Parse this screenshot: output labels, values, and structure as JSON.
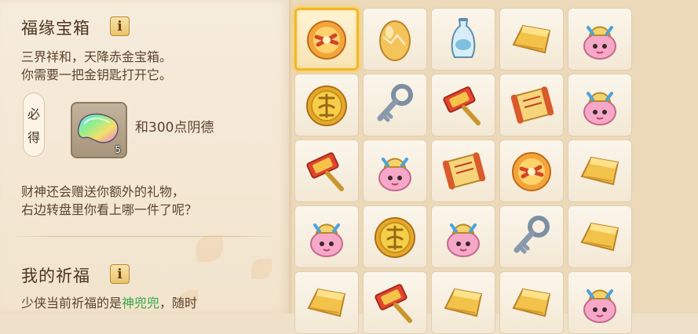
{
  "treasure": {
    "title": "福缘宝箱",
    "info_label": "i",
    "desc_line1": "三界祥和，天降赤金宝箱。",
    "desc_line2": "你需要一把金钥匙打开它。",
    "must_char1": "必",
    "must_char2": "得",
    "reward_qty": "5",
    "reward_text": "和300点阴德",
    "gift_line1": "财神还会赠送你额外的礼物，",
    "gift_line2": "右边转盘里你看上哪一件了呢？"
  },
  "blessing": {
    "title": "我的祈福",
    "info_label": "i",
    "line_prefix": "少侠当前祈福的是",
    "highlight": "神兜兜",
    "line_suffix": "，随时"
  },
  "colors": {
    "highlight": "#3aa84a",
    "selected_border": "#f0b72a",
    "title_text": "#4b3320"
  },
  "grid_items": [
    [
      "gold-medallion-icon",
      "golden-egg-icon",
      "porcelain-vase-icon",
      "gold-ingot-icon",
      "lucky-bag-doll-icon"
    ],
    [
      "dream-coin-icon",
      "silver-key-icon",
      "red-hammer-icon",
      "scroll-icon",
      "lucky-bag-doll-icon"
    ],
    [
      "red-hammer-icon",
      "lucky-bag-doll-icon",
      "scroll-icon",
      "gold-medallion-icon",
      "gold-ingot-icon"
    ],
    [
      "lucky-bag-doll-icon",
      "dream-coin-icon",
      "lucky-bag-doll-icon",
      "silver-key-icon",
      "gold-ingot-icon"
    ],
    [
      "gold-ingot-icon",
      "red-hammer-icon",
      "gold-ingot-icon",
      "gold-ingot-icon",
      "lucky-bag-doll-icon"
    ]
  ],
  "selected_cell": {
    "row": 0,
    "col": 0
  }
}
